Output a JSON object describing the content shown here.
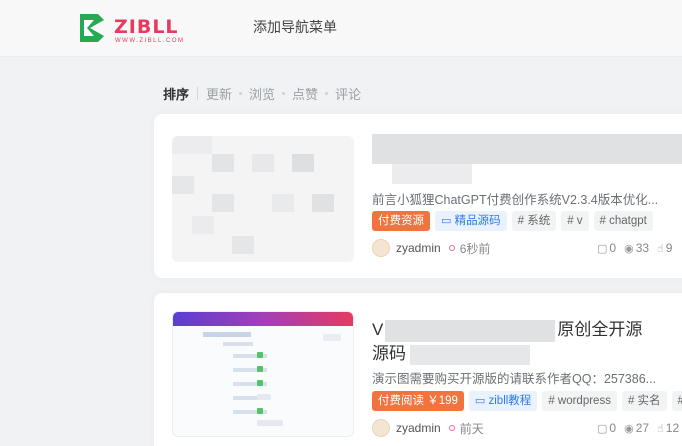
{
  "header": {
    "logo_text": "ZIBLL",
    "logo_sub": "WWW.ZIBLL.COM",
    "nav_label": "添加导航菜单"
  },
  "sort": {
    "items": [
      "排序",
      "更新",
      "浏览",
      "点赞",
      "评论"
    ]
  },
  "posts": [
    {
      "excerpt": "前言小狐狸ChatGPT付费创作系统V2.3.4版本优化...",
      "tags": [
        "付费资源",
        "精品源码",
        "# 系统",
        "# v",
        "# chatgpt"
      ],
      "author": "zyadmin",
      "time": "6秒前",
      "comments": "0",
      "views": "33",
      "likes": "9"
    },
    {
      "title_prefix": "V",
      "title_suffix": "原创全开源",
      "title_line2": "源码",
      "excerpt": "演示图需要购买开源版的请联系作者QQ：257386...",
      "tags": [
        "付费阅读 ￥199",
        "zibll教程",
        "# wordpress",
        "# 实名",
        "# "
      ],
      "author": "zyadmin",
      "time": "前天",
      "comments": "0",
      "views": "27",
      "likes": "12"
    }
  ],
  "colors": {
    "brand": "#e8395f",
    "logo_green": "#27a954",
    "paid_tag": "#f1733e",
    "category_tag": "#2c7be5"
  }
}
